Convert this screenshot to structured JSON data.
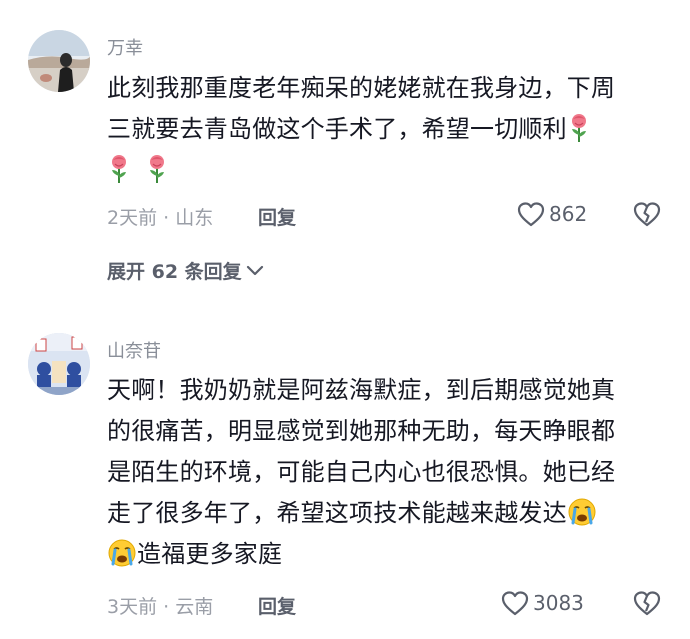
{
  "comments": [
    {
      "username": "万幸",
      "lines": [
        "此刻我那重度老年痴呆的姥姥就在我身边，下周",
        "三就要去青岛做这个手术了，希望一切顺利"
      ],
      "emoji": [
        "rose-emoji",
        "rose-emoji",
        "rose-emoji"
      ],
      "time_location": "2天前 · 山东",
      "reply_label": "回复",
      "likes": "862",
      "expand_label": "展开 62 条回复"
    },
    {
      "username": "山奈苷",
      "lines": [
        "天啊！我奶奶就是阿兹海默症，到后期感觉她真",
        "的很痛苦，明显感觉到她那种无助，每天睁眼都",
        "是陌生的环境，可能自己内心也很恐惧。她已经",
        "走了很多年了，希望这项技术能越来越发达",
        "造福更多家庭"
      ],
      "emoji": [
        "crying-emoji",
        "crying-emoji"
      ],
      "time_location": "3天前 · 云南",
      "reply_label": "回复",
      "likes": "3083"
    }
  ],
  "colors": {
    "text": "#161823",
    "muted": "#8a8f99",
    "action": "#5a5f6b"
  }
}
